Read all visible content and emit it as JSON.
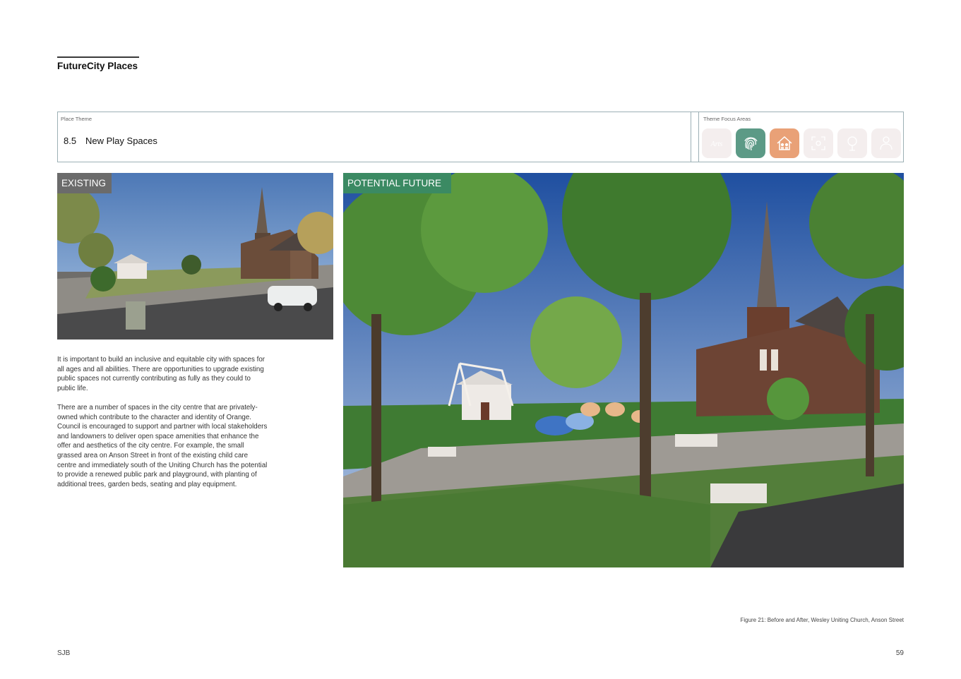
{
  "header": {
    "title": "FutureCity Places"
  },
  "theme": {
    "label": "Place Theme",
    "number": "8.5",
    "title": "New Play Spaces",
    "focus_label": "Theme Focus Areas",
    "focus_icons": [
      {
        "name": "Arts-icon",
        "active": false,
        "color": "#f4eeee"
      },
      {
        "name": "fingerprint-icon",
        "active": true,
        "color": "#5c9a86"
      },
      {
        "name": "family-house-icon",
        "active": true,
        "color": "#e9a177"
      },
      {
        "name": "expand-frame-icon",
        "active": false,
        "color": "#f4eeee"
      },
      {
        "name": "tree-icon",
        "active": false,
        "color": "#f4eeee"
      },
      {
        "name": "person-icon",
        "active": false,
        "color": "#f4eeee"
      }
    ]
  },
  "photos": {
    "existing_label": "EXISTING",
    "future_label": "POTENTIAL FUTURE"
  },
  "body": {
    "paragraph1": "It is important to build an inclusive and equitable city with spaces for all ages and all abilities. There are opportunities to upgrade existing public spaces not currently contributing as fully as they could to public life.",
    "paragraph2": "There are a number of spaces in the city centre that are privately-owned which contribute to the character and identity of Orange. Council is encouraged to support and partner with local stakeholders and landowners to deliver open space amenities that enhance the offer and aesthetics of the city centre. For example, the small grassed area on Anson Street in front of the existing child care centre and immediately south of the Uniting Church has the potential to provide a renewed public park and playground, with planting of additional trees, garden beds, seating and play equipment."
  },
  "caption": "Figure 21: Before and After, Wesley Uniting Church, Anson Street",
  "footer": {
    "left": "SJB",
    "page": "59"
  }
}
